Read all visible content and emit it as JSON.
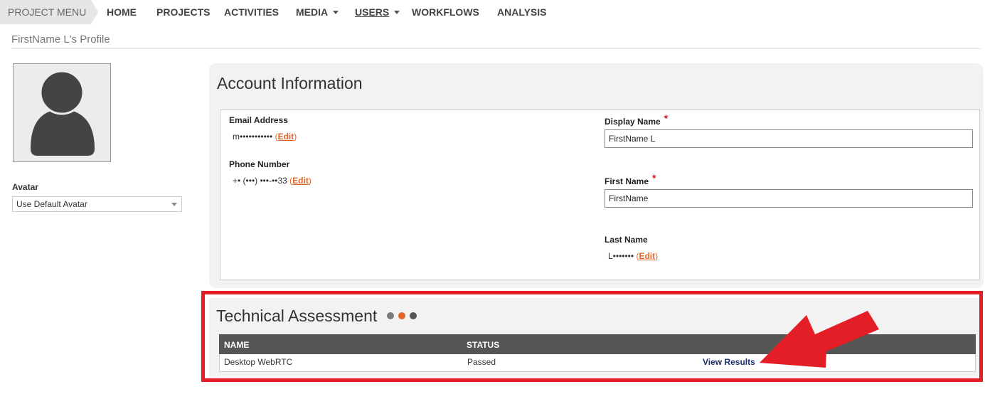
{
  "nav": {
    "project_menu": "PROJECT MENU",
    "items": [
      {
        "label": "HOME"
      },
      {
        "label": "PROJECTS"
      },
      {
        "label": "ACTIVITIES"
      },
      {
        "label": "MEDIA"
      },
      {
        "label": "USERS"
      },
      {
        "label": "WORKFLOWS"
      },
      {
        "label": "ANALYSIS"
      }
    ]
  },
  "page": {
    "title": "FirstName L's Profile"
  },
  "avatar": {
    "label": "Avatar",
    "select_value": "Use Default Avatar",
    "icon": "default-user-icon"
  },
  "account": {
    "title": "Account Information",
    "email_label": "Email Address",
    "email_value": "m•••••••••••",
    "phone_label": "Phone Number",
    "phone_value": "+• (•••) •••-••33",
    "edit_label": "Edit",
    "display_name_label": "Display Name",
    "display_name_value": "FirstName L",
    "first_name_label": "First Name",
    "first_name_value": "FirstName",
    "last_name_label": "Last Name",
    "last_name_value": "L•••••••",
    "required_mark": "*"
  },
  "assessment": {
    "title": "Technical Assessment",
    "columns": {
      "name": "NAME",
      "status": "STATUS"
    },
    "rows": [
      {
        "name": "Desktop WebRTC",
        "status": "Passed",
        "action": "View Results"
      }
    ],
    "dot_colors": [
      "#7a7a7a",
      "#e0662a",
      "#555555"
    ]
  },
  "colors": {
    "accent": "#e0662a",
    "highlight": "#e41e26",
    "header_bg": "#555555"
  }
}
